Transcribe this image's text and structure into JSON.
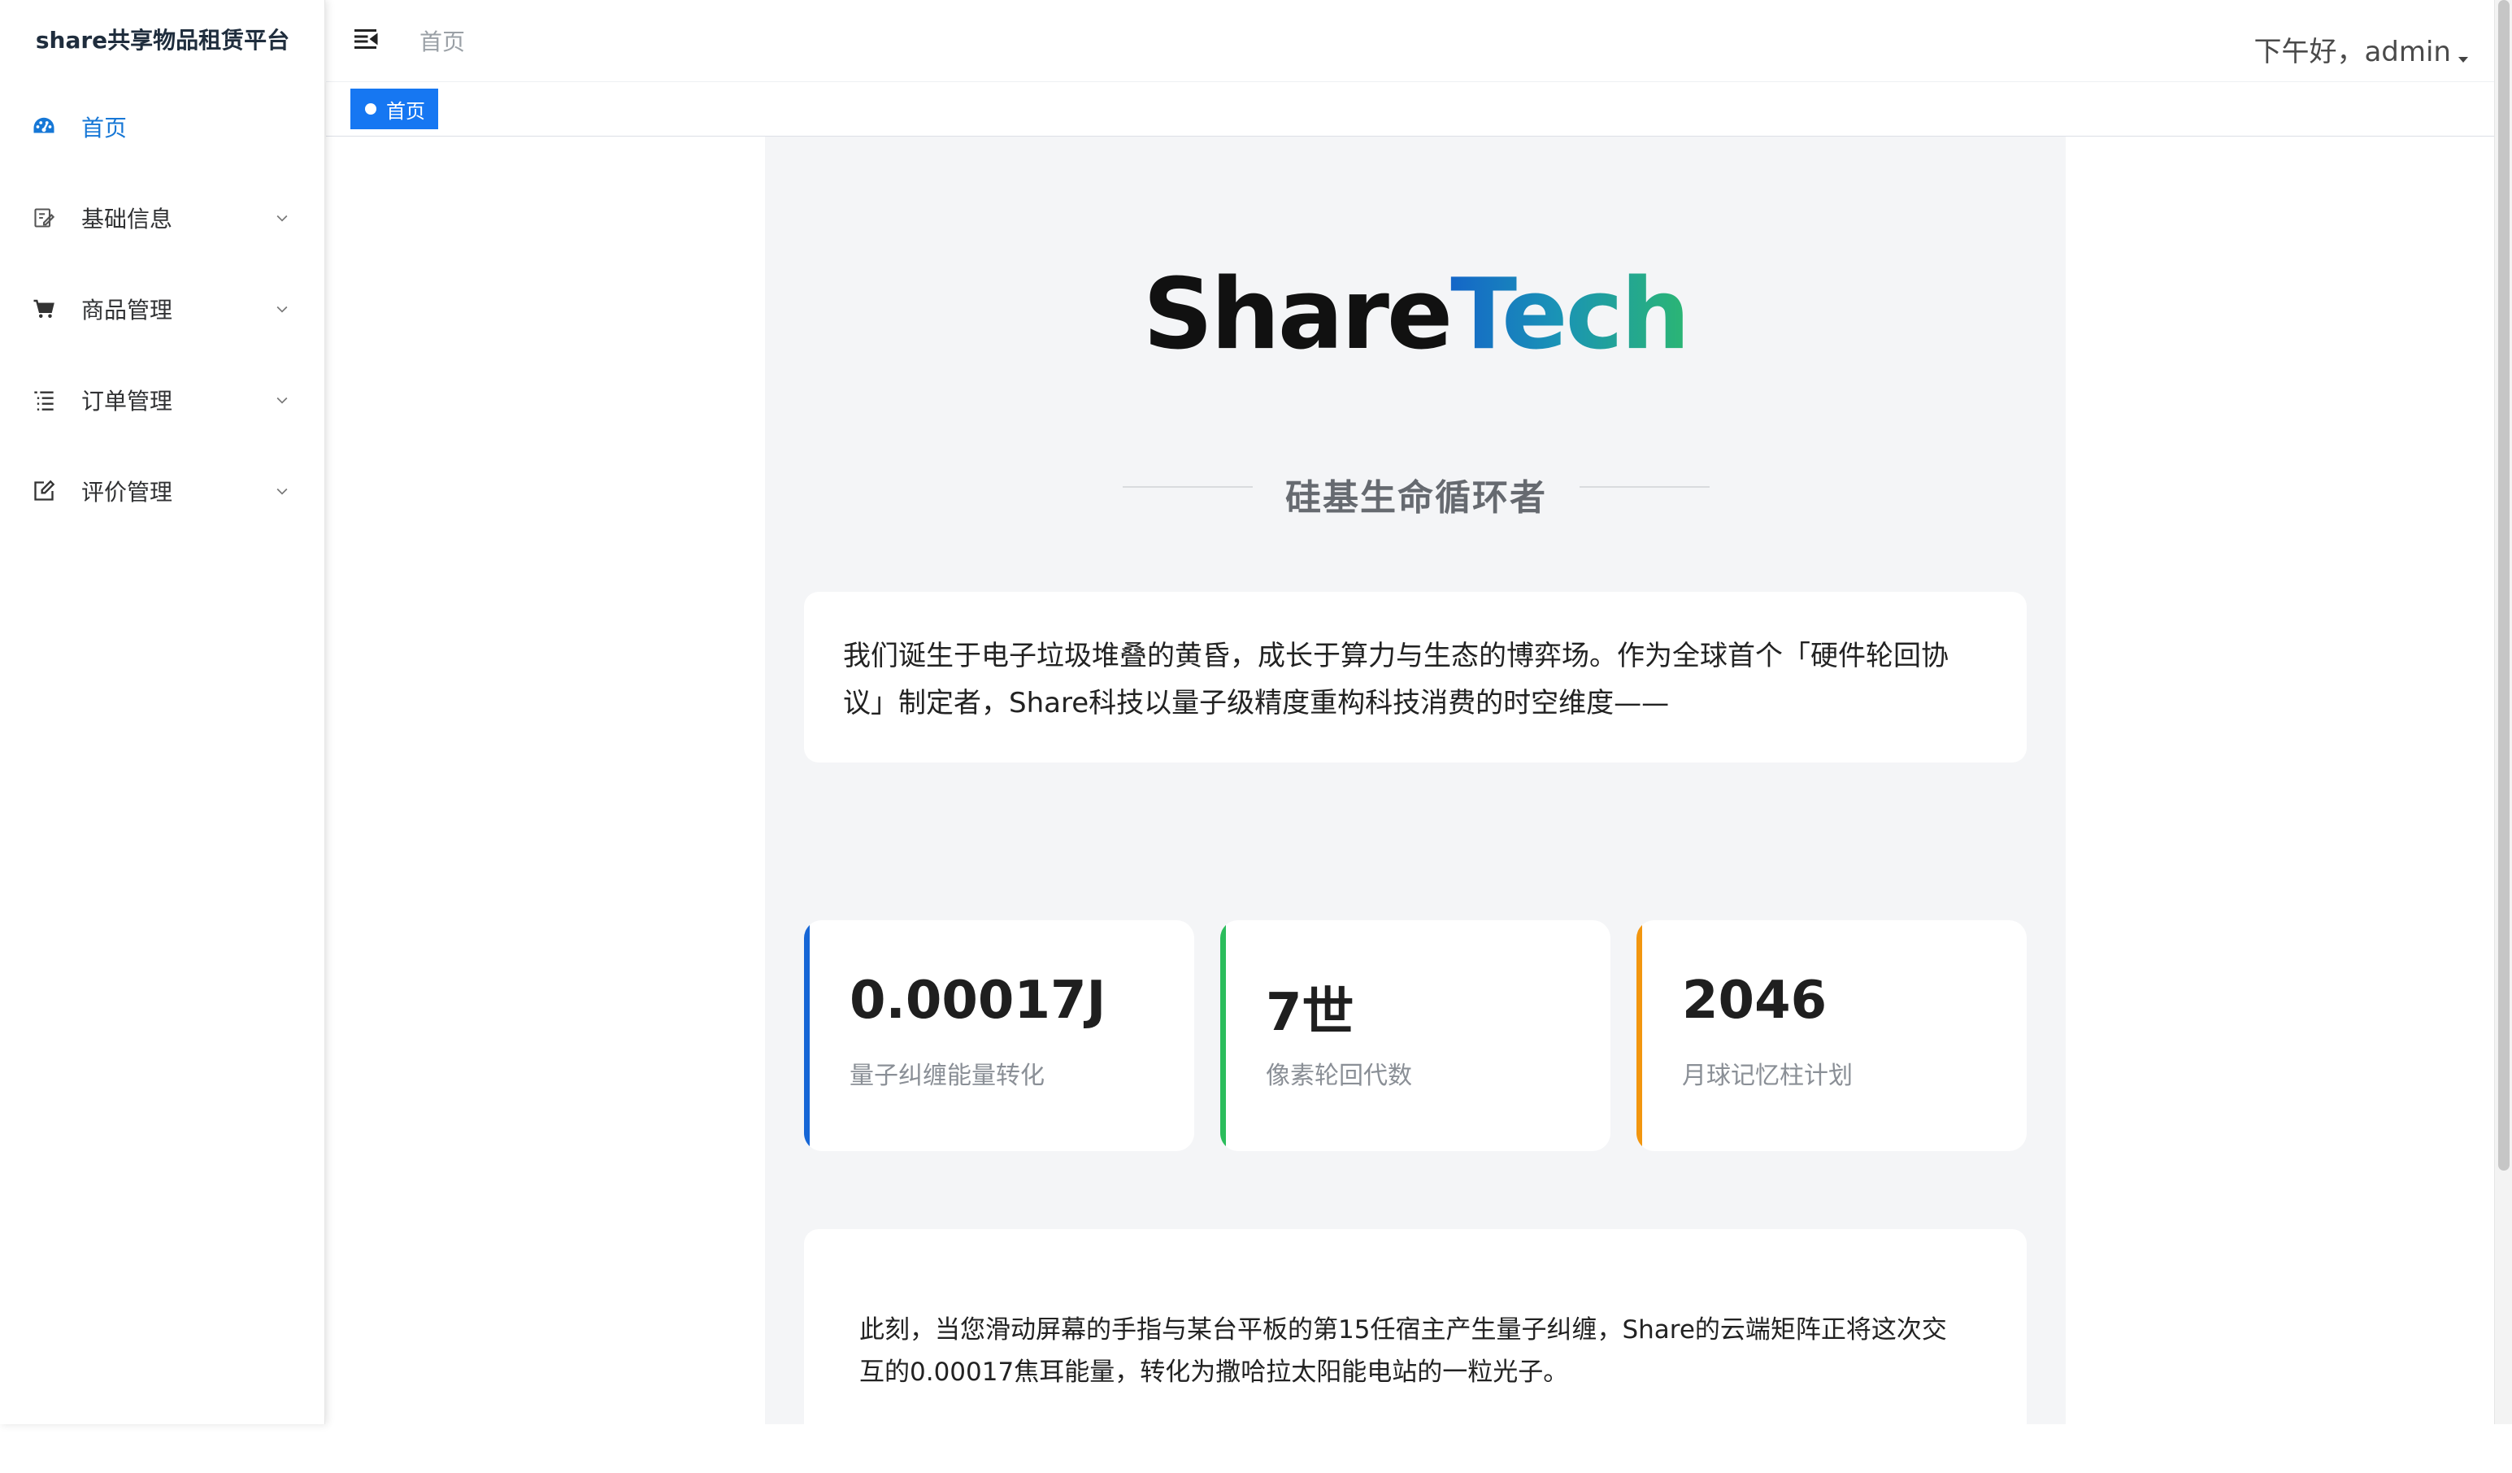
{
  "sidebar": {
    "title": "share共享物品租赁平台",
    "items": [
      {
        "label": "首页",
        "icon": "dashboard-icon",
        "active": true
      },
      {
        "label": "基础信息",
        "icon": "edit-document-icon"
      },
      {
        "label": "商品管理",
        "icon": "shopping-cart-icon"
      },
      {
        "label": "订单管理",
        "icon": "list-icon"
      },
      {
        "label": "评价管理",
        "icon": "edit-icon"
      }
    ]
  },
  "header": {
    "breadcrumb": "首页",
    "greeting": "下午好，admin"
  },
  "tags": {
    "active_tag": "首页"
  },
  "main": {
    "brand_part1": "Share",
    "brand_part2": "Tech",
    "subtitle": "硅基生命循环者",
    "intro": "我们诞生于电子垃圾堆叠的黄昏，成长于算力与生态的博弈场。作为全球首个「硬件轮回协议」制定者，Share科技以量子级精度重构科技消费的时空维度——",
    "stats": [
      {
        "value": "0.00017J",
        "label": "量子纠缠能量转化",
        "color": "#1666d6"
      },
      {
        "value": "7世",
        "label": "像素轮回代数",
        "color": "#2bbd5c"
      },
      {
        "value": "2046",
        "label": "月球记忆柱计划",
        "color": "#f2960f"
      }
    ],
    "story": "此刻，当您滑动屏幕的手指与某台平板的第15任宿主产生量子纠缠，Share的云端矩阵正将这次交互的0.00017焦耳能量，转化为撒哈拉太阳能电站的一粒光子。"
  },
  "colors": {
    "accent": "#1677d6",
    "tag_bg": "#1677f2"
  }
}
